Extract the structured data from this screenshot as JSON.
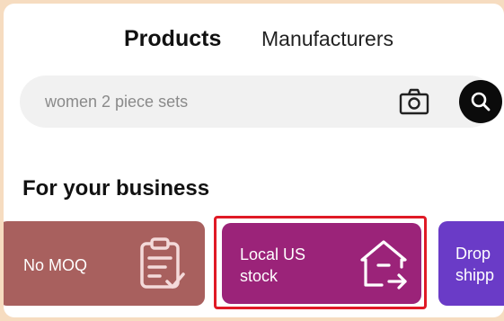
{
  "tabs": {
    "products": "Products",
    "manufacturers": "Manufacturers"
  },
  "search": {
    "placeholder": "women 2 piece sets",
    "camera_icon": "camera-icon",
    "search_icon": "search-icon"
  },
  "section": {
    "title": "For your business"
  },
  "cards": [
    {
      "label": "No MOQ",
      "icon": "clipboard-check-icon",
      "color": "#a8605e"
    },
    {
      "label": "Local US\nstock",
      "icon": "house-arrow-icon",
      "color": "#9b2379"
    },
    {
      "label": "Drop\nshipp",
      "icon": "",
      "color": "#6a3bc7"
    }
  ],
  "colors": {
    "highlight": "#e01a26",
    "background": "#f6dcc0"
  }
}
